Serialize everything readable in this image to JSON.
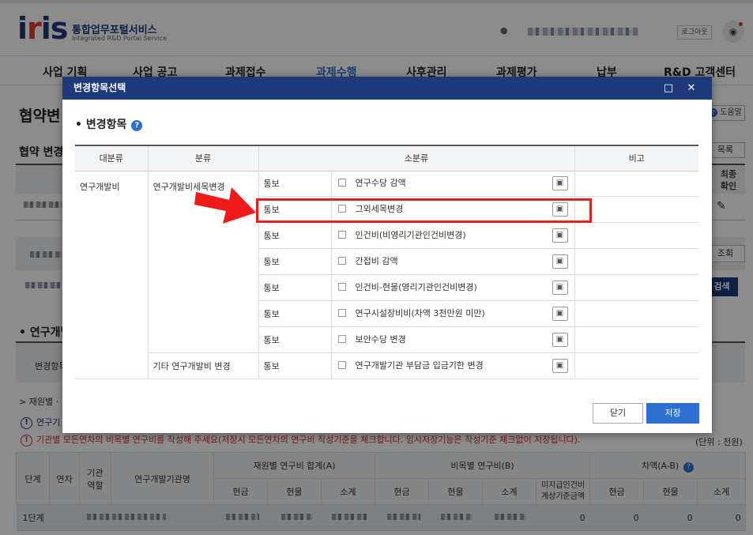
{
  "header": {
    "logo": "iris",
    "brand_ko": "통합업무포털서비스",
    "brand_en": "Integrated R&D Portal Service",
    "logout": "로그아웃"
  },
  "gnb": [
    {
      "label": "사업 기획"
    },
    {
      "label": "사업 공고"
    },
    {
      "label": "과제접수"
    },
    {
      "label": "과제수행",
      "active": true
    },
    {
      "label": "사후관리"
    },
    {
      "label": "과제평가"
    },
    {
      "label": "납부"
    },
    {
      "label": "R&D 고객센터"
    }
  ],
  "page": {
    "title": "협약변",
    "help": "도움말",
    "sub_title": "협약 변경",
    "list_btn": "목록",
    "final_confirm": "최종\n확인",
    "query_btn": "조회",
    "search_btn": "검색",
    "section_title": "• 연구개발",
    "change_item_label": "변경항목",
    "fund_row": "> 재원별 ·",
    "info1": "연구기",
    "info2": "기관별 모든연차의 비목별 연구비를 작성해 주세요(저장시 모든연차의 연구비 작성기준을 체크합니다. 임시저장기능은 작성기준 체크없이 저장됩니다).",
    "unit": "(단위 : 천원)"
  },
  "budget_table": {
    "headers": {
      "stage": "단계",
      "year": "연차",
      "role": "기관\n역할",
      "org": "연구개발기관명",
      "fund_sum": "재원별 연구비 합계(A)",
      "item_cost": "비목별 연구비(B)",
      "diff": "차액(A-B)",
      "cash": "현금",
      "goods": "현물",
      "subtotal": "소계",
      "unpaid": "미지급인건비\n계상기준금액"
    },
    "row": {
      "stage": "1단계",
      "unpaid": "0",
      "diff_cash": "0",
      "diff_goods": "0",
      "diff_sub": "0"
    }
  },
  "modal": {
    "title": "변경항목선택",
    "max_icon": "□",
    "close_icon": "✕",
    "subtitle": "• 변경항목",
    "columns": {
      "major": "대분류",
      "category": "분류",
      "minor": "소분류",
      "note": "비고"
    },
    "major_value": "연구개발비",
    "groups": [
      {
        "category": "연구개발비세목변경",
        "rows": [
          {
            "type": "통보",
            "item": "연구수당 감액"
          },
          {
            "type": "통보",
            "item": "그외세목변경"
          },
          {
            "type": "통보",
            "item": "인건비(비영리기관인건비변경)"
          },
          {
            "type": "통보",
            "item": "간접비 감액"
          },
          {
            "type": "통보",
            "item": "인건비-현물(영리기관인건비변경)"
          },
          {
            "type": "통보",
            "item": "연구시설장비비(차액 3천만원 미만)"
          },
          {
            "type": "통보",
            "item": "보안수당 변경"
          }
        ]
      },
      {
        "category": "기타 연구개발비 변경",
        "rows": [
          {
            "type": "통보",
            "item": "연구개발기관 부담금 입금기한 변경"
          }
        ]
      }
    ],
    "close_btn": "닫기",
    "save_btn": "저장"
  },
  "colors": {
    "navy": "#1e3a7a",
    "accent_blue": "#2d6fd0",
    "highlight_red": "#e81e1e",
    "warning_red": "#d4322b"
  }
}
